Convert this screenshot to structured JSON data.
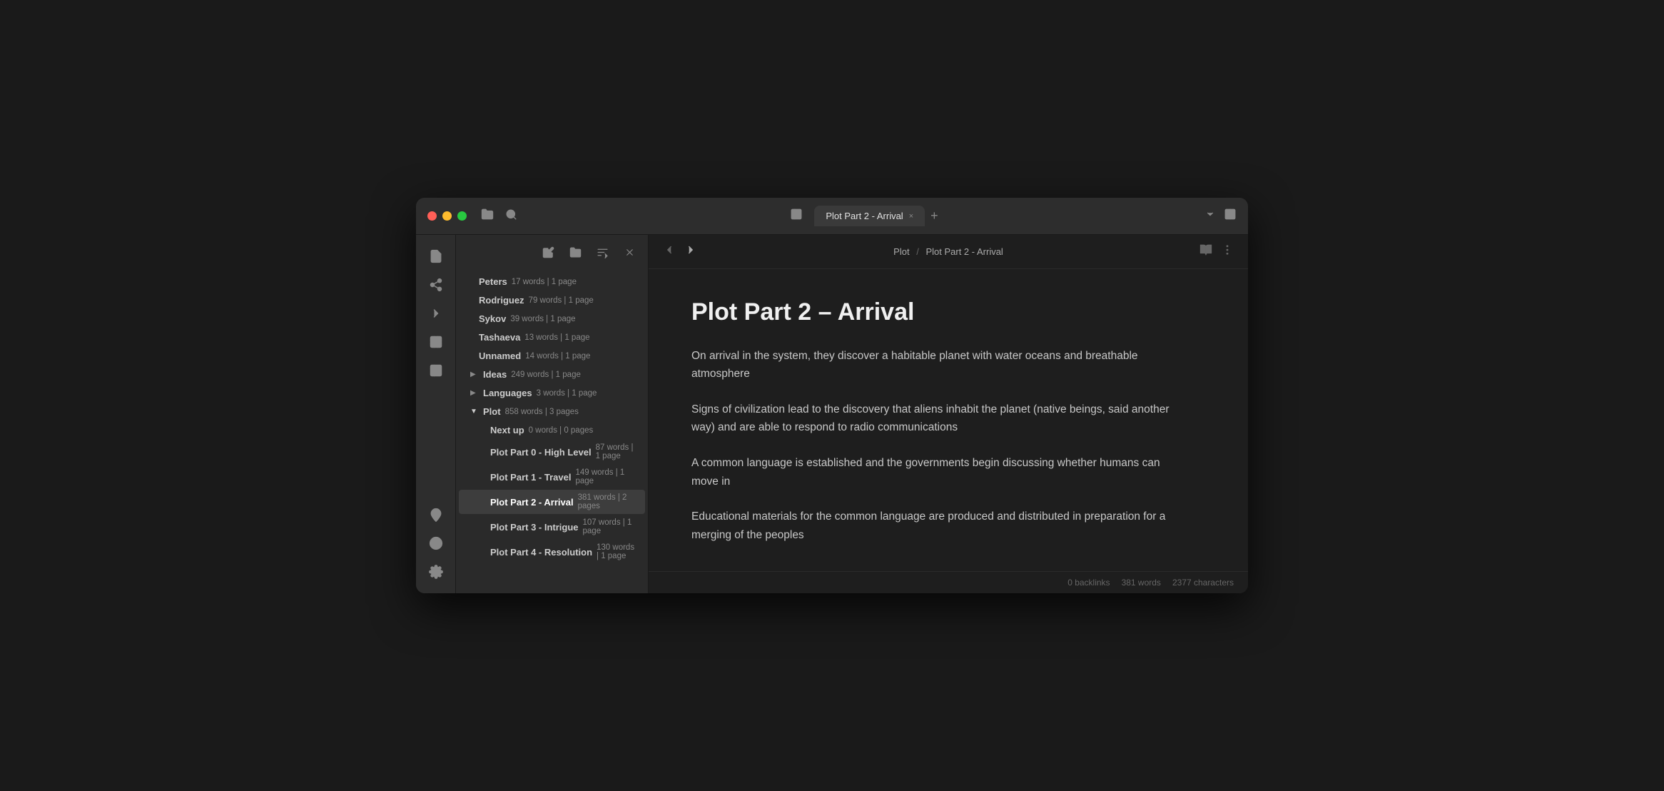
{
  "window": {
    "tab_label": "Plot Part 2 - Arrival",
    "tab_close": "×",
    "tab_add": "+"
  },
  "titlebar": {
    "file_icon": "📁",
    "search_icon": "🔍",
    "sidebar_toggle": "⊟",
    "dropdown_icon": "⌄",
    "layout_icon": "⊡"
  },
  "iconbar": {
    "top_icons": [
      {
        "name": "files-icon",
        "symbol": "📄"
      },
      {
        "name": "graph-icon",
        "symbol": "⚙"
      },
      {
        "name": "terminal-icon",
        "symbol": ">"
      },
      {
        "name": "table-icon",
        "symbol": "⊞"
      },
      {
        "name": "layout-icon",
        "symbol": "⊟"
      }
    ],
    "bottom_icons": [
      {
        "name": "location-icon",
        "symbol": "📍"
      },
      {
        "name": "help-icon",
        "symbol": "?"
      },
      {
        "name": "settings-icon",
        "symbol": "⚙"
      }
    ]
  },
  "sidebar": {
    "toolbar": {
      "edit_icon": "✏",
      "new_folder_icon": "📁+",
      "sort_icon": "⇅",
      "close_icon": "×"
    },
    "tree": [
      {
        "level": 1,
        "type": "leaf",
        "name": "Peters",
        "meta": "17 words | 1 page",
        "active": false
      },
      {
        "level": 1,
        "type": "leaf",
        "name": "Rodriguez",
        "meta": "79 words | 1 page",
        "active": false
      },
      {
        "level": 1,
        "type": "leaf",
        "name": "Sykov",
        "meta": "39 words | 1 page",
        "active": false
      },
      {
        "level": 1,
        "type": "leaf",
        "name": "Tashaeva",
        "meta": "13 words | 1 page",
        "active": false
      },
      {
        "level": 1,
        "type": "leaf",
        "name": "Unnamed",
        "meta": "14 words | 1 page",
        "active": false
      },
      {
        "level": 0,
        "type": "collapsed",
        "name": "Ideas",
        "meta": "249 words | 1 page",
        "active": false
      },
      {
        "level": 0,
        "type": "collapsed",
        "name": "Languages",
        "meta": "3 words | 1 page",
        "active": false
      },
      {
        "level": 0,
        "type": "expanded",
        "name": "Plot",
        "meta": "858 words | 3 pages",
        "active": false
      },
      {
        "level": 1,
        "type": "leaf",
        "name": "Next up",
        "meta": "0 words | 0 pages",
        "active": false
      },
      {
        "level": 1,
        "type": "leaf",
        "name": "Plot Part 0 - High Level",
        "meta": "87 words | 1 page",
        "active": false
      },
      {
        "level": 1,
        "type": "leaf",
        "name": "Plot Part 1 - Travel",
        "meta": "149 words | 1 page",
        "active": false
      },
      {
        "level": 1,
        "type": "leaf",
        "name": "Plot Part 2 - Arrival",
        "meta": "381 words | 2 pages",
        "active": true
      },
      {
        "level": 1,
        "type": "leaf",
        "name": "Plot Part 3 - Intrigue",
        "meta": "107 words | 1 page",
        "active": false
      },
      {
        "level": 1,
        "type": "leaf",
        "name": "Plot Part 4 - Resolution",
        "meta": "130 words | 1 page",
        "active": false
      }
    ]
  },
  "editor": {
    "breadcrumb_parent": "Plot",
    "breadcrumb_current": "Plot Part 2 - Arrival",
    "title": "Plot Part 2 – Arrival",
    "paragraphs": [
      "On arrival in the system, they discover a habitable planet with water oceans and breathable atmosphere",
      "Signs of civilization lead to the discovery that aliens inhabit the planet (native beings, said another way) and are able to respond to radio communications",
      "A common language is established and the governments begin discussing whether humans can move in",
      "Educational materials for the common language are produced and distributed in preparation for a merging of the peoples"
    ],
    "status": {
      "backlinks": "0 backlinks",
      "words": "381 words",
      "characters": "2377 characters"
    }
  }
}
